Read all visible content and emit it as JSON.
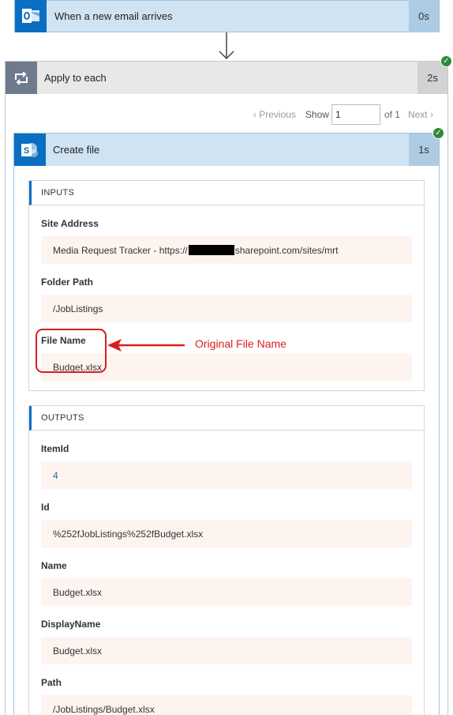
{
  "trigger": {
    "title": "When a new email arrives",
    "duration": "0s",
    "icon": "outlook-icon"
  },
  "loop": {
    "title": "Apply to each",
    "duration": "2s",
    "icon": "loop-icon"
  },
  "pager": {
    "previous": "Previous",
    "show": "Show",
    "value": "1",
    "of": "of 1",
    "next": "Next"
  },
  "create": {
    "title": "Create file",
    "duration": "1s",
    "icon": "sharepoint-icon"
  },
  "inputs": {
    "title": "INPUTS",
    "site_label": "Site Address",
    "site_prefix": "Media Request Tracker - https://",
    "site_suffix": "sharepoint.com/sites/mrt",
    "folder_label": "Folder Path",
    "folder_value": "/JobListings",
    "filename_label": "File Name",
    "filename_value": "Budget.xlsx"
  },
  "annotation": {
    "text": "Original File Name",
    "color": "#d81e1e"
  },
  "outputs": {
    "title": "OUTPUTS",
    "fields": [
      {
        "label": "ItemId",
        "value": "4"
      },
      {
        "label": "Id",
        "value": "%252fJobListings%252fBudget.xlsx"
      },
      {
        "label": "Name",
        "value": "Budget.xlsx"
      },
      {
        "label": "DisplayName",
        "value": "Budget.xlsx"
      },
      {
        "label": "Path",
        "value": "/JobListings/Budget.xlsx"
      }
    ]
  },
  "colors": {
    "accent": "#0a6fc2",
    "success": "#2e8b3d"
  }
}
